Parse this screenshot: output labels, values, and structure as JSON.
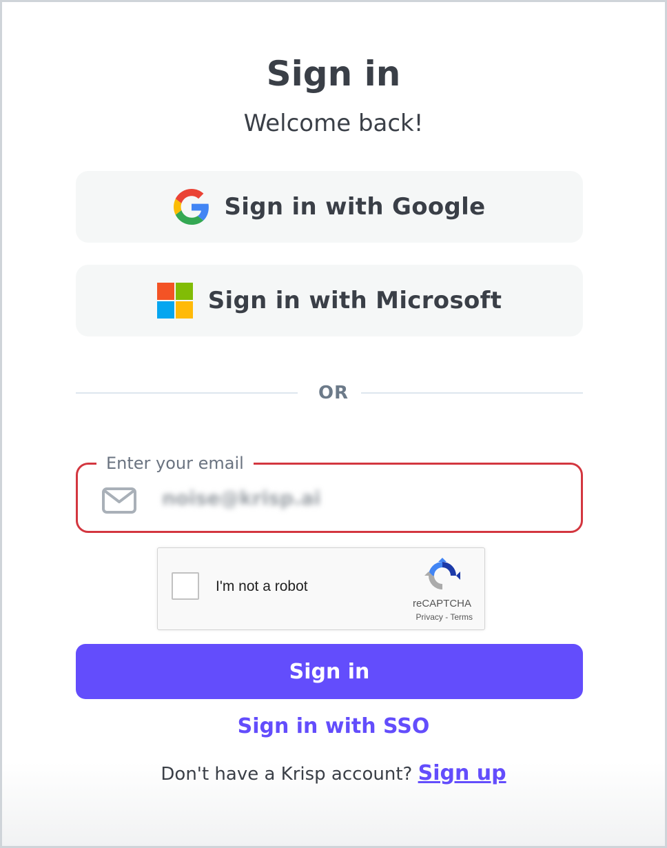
{
  "header": {
    "title": "Sign in",
    "subtitle": "Welcome back!"
  },
  "oauth": {
    "google_label": "Sign in with Google",
    "microsoft_label": "Sign in with Microsoft"
  },
  "divider": {
    "text": "OR"
  },
  "email": {
    "label": "Enter your email",
    "value": "noise@krisp.ai",
    "icon": "mail-icon",
    "border_color": "#d3363f"
  },
  "recaptcha": {
    "label": "I'm not a robot",
    "brand": "reCAPTCHA",
    "links": "Privacy - Terms"
  },
  "actions": {
    "signin_label": "Sign in",
    "sso_label": "Sign in with SSO"
  },
  "footer": {
    "prompt": "Don't have a Krisp account?",
    "signup_label": "Sign up"
  },
  "colors": {
    "accent": "#634dfc",
    "text": "#3a3f47",
    "button_bg": "#f5f7f7",
    "error": "#d3363f"
  }
}
